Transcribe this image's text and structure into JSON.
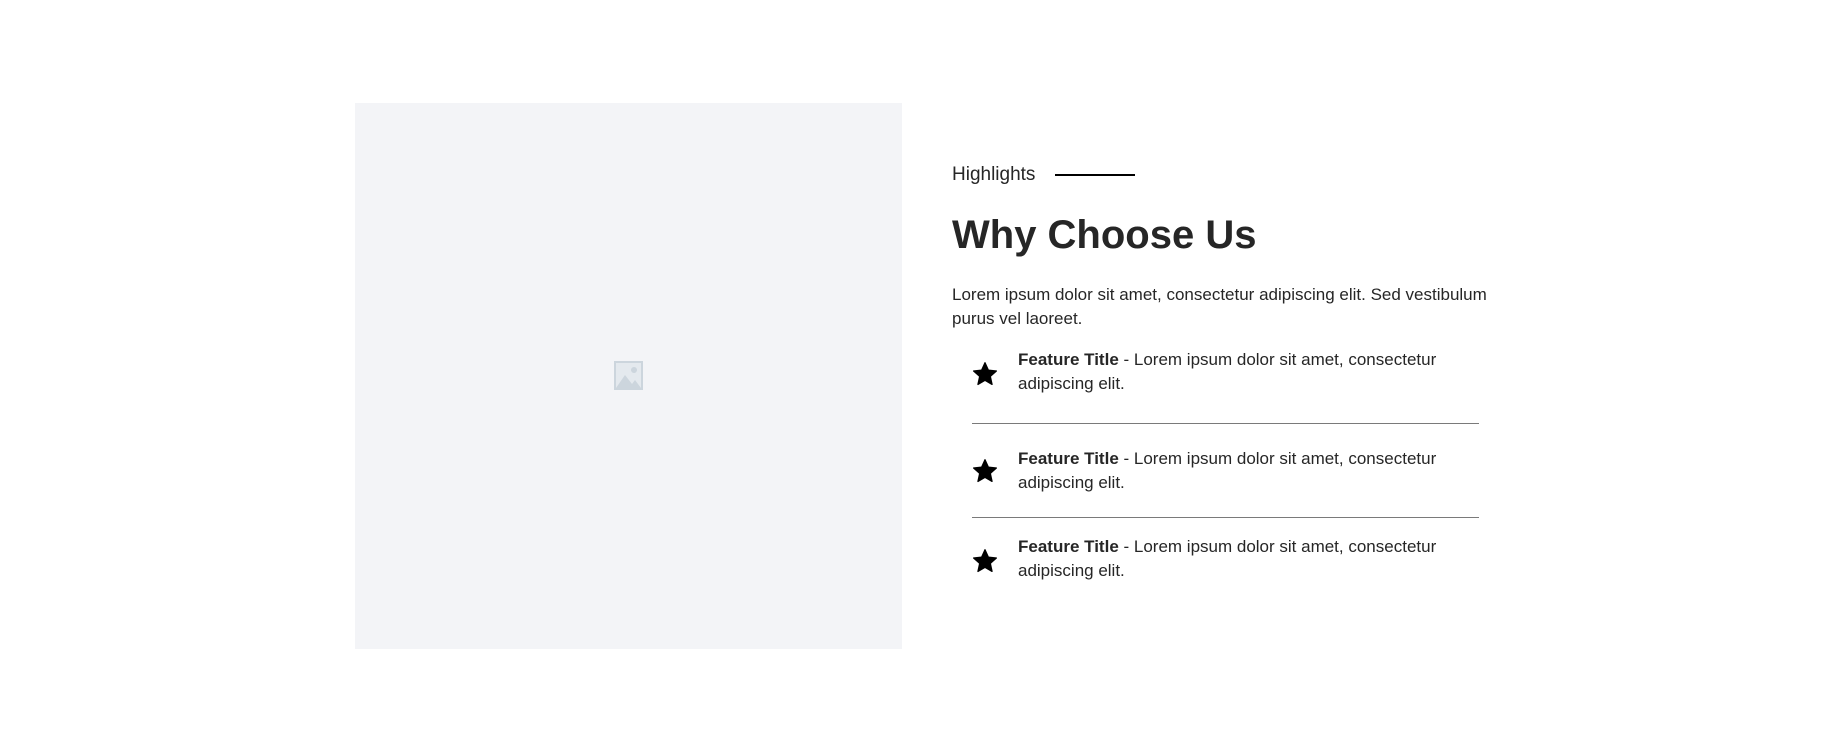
{
  "section": {
    "eyebrow": "Highlights",
    "title": "Why Choose Us",
    "lead": "Lorem ipsum dolor sit amet, consectetur adipiscing elit. Sed vestibulum purus vel laoreet."
  },
  "features": [
    {
      "title": "Feature Title",
      "text": " - Lorem ipsum dolor sit amet, consectetur adipiscing elit.",
      "icon": "star-icon"
    },
    {
      "title": "Feature Title",
      "text": " - Lorem ipsum dolor sit amet, consectetur adipiscing elit.",
      "icon": "star-icon"
    },
    {
      "title": "Feature Title",
      "text": " - Lorem ipsum dolor sit amet, consectetur adipiscing elit.",
      "icon": "star-icon"
    }
  ],
  "image": {
    "icon": "image-placeholder-icon",
    "background": "#f3f4f7"
  },
  "colors": {
    "text": "#262626",
    "accent_line": "#000000",
    "divider": "#7a7a7a"
  }
}
